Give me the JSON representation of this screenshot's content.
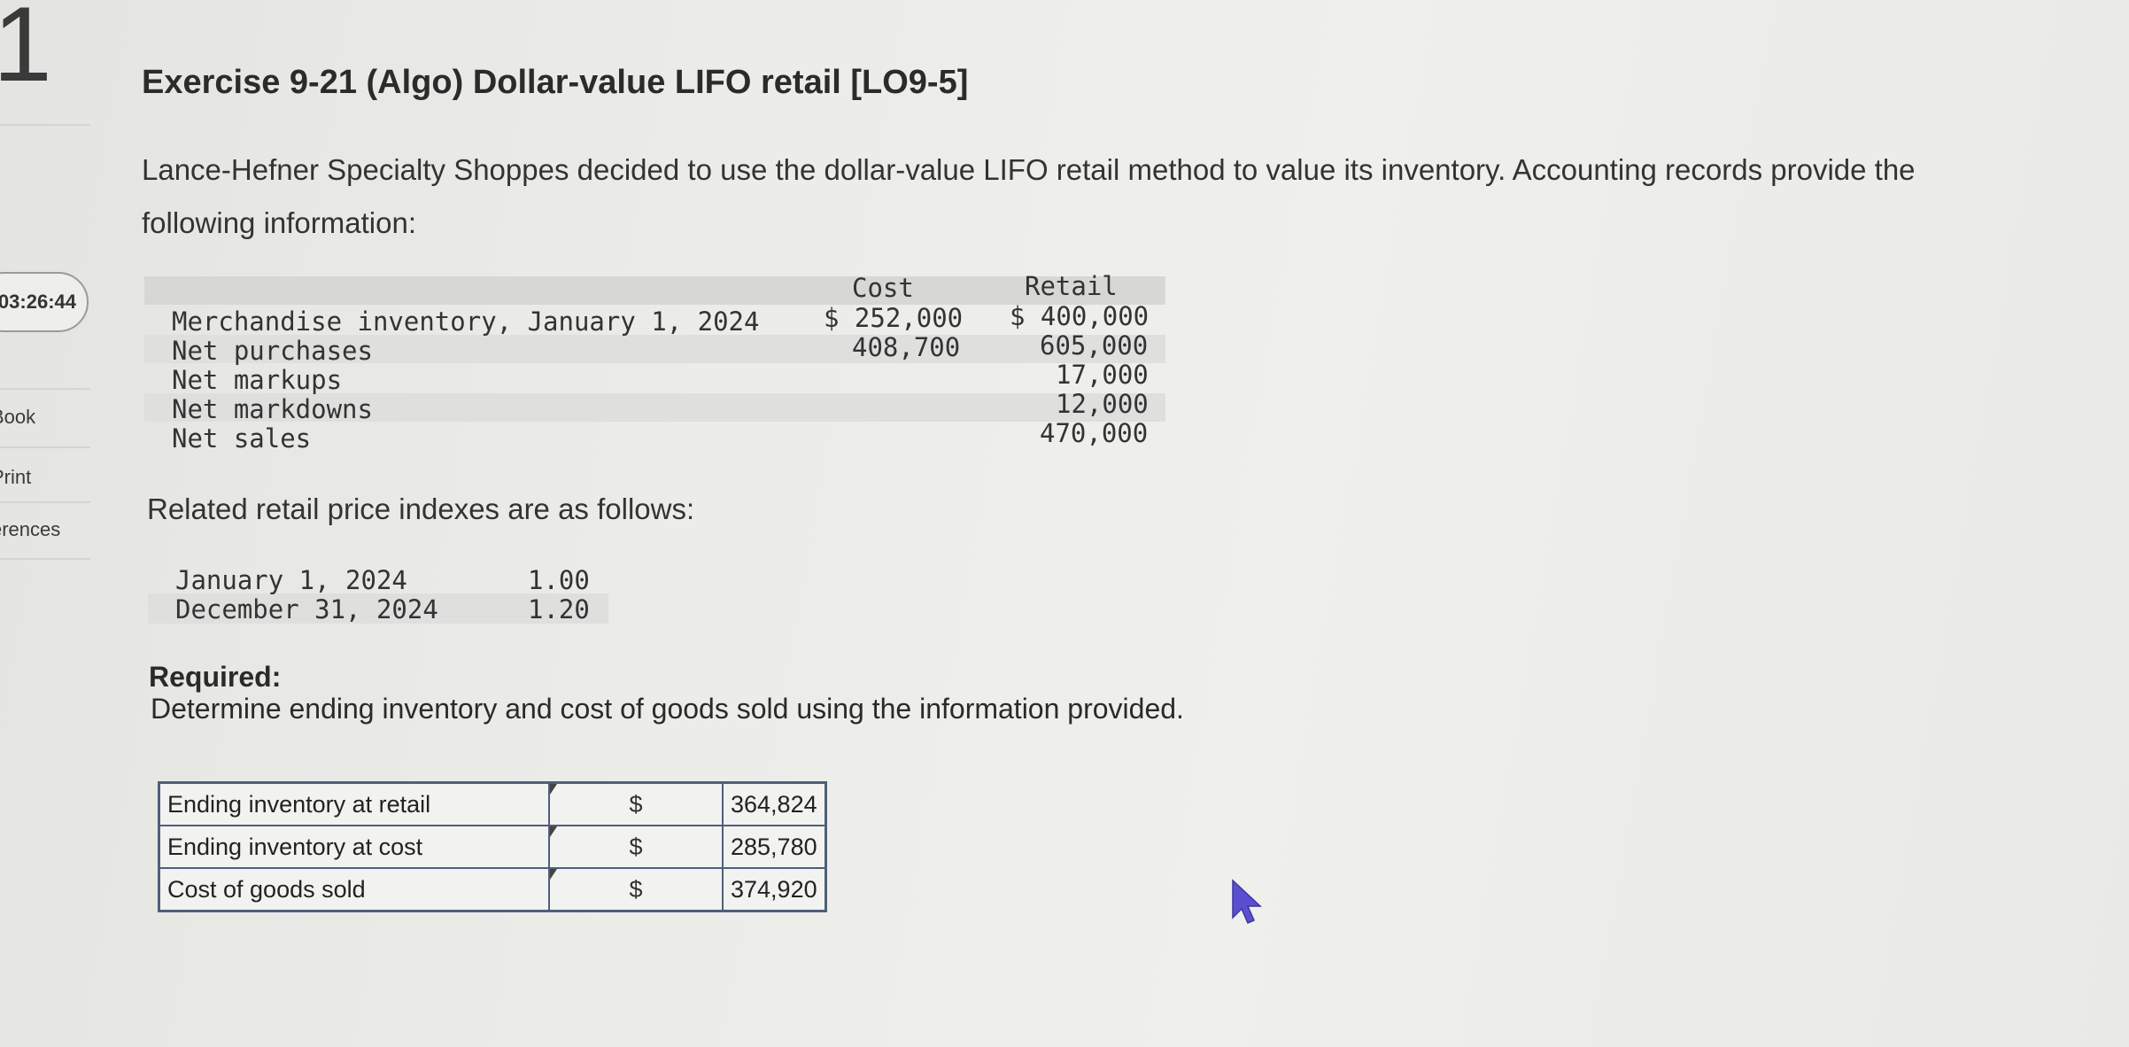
{
  "sidebar": {
    "page_number": "1",
    "timer": "03:26:44",
    "links": [
      "Book",
      "Print",
      "erences"
    ]
  },
  "exercise": {
    "title": "Exercise 9-21 (Algo) Dollar-value LIFO retail [LO9-5]",
    "intro": "Lance-Hefner Specialty Shoppes decided to use the dollar-value LIFO retail method to value its inventory. Accounting records provide the following information:"
  },
  "info_table": {
    "headers": {
      "cost": "Cost",
      "retail": "Retail"
    },
    "rows": [
      {
        "label": "Merchandise inventory, January 1, 2024",
        "cost": "$ 252,000",
        "retail": "$ 400,000"
      },
      {
        "label": "Net purchases",
        "cost": "408,700",
        "retail": "605,000"
      },
      {
        "label": "Net markups",
        "cost": "",
        "retail": "17,000"
      },
      {
        "label": "Net markdowns",
        "cost": "",
        "retail": "12,000"
      },
      {
        "label": "Net sales",
        "cost": "",
        "retail": "470,000"
      }
    ]
  },
  "indexes": {
    "intro": "Related retail price indexes are as follows:",
    "rows": [
      {
        "date": "January 1, 2024",
        "value": "1.00"
      },
      {
        "date": "December 31, 2024",
        "value": "1.20"
      }
    ]
  },
  "required": {
    "heading": "Required:",
    "text": "Determine ending inventory and cost of goods sold using the information provided."
  },
  "answers": [
    {
      "label": "Ending inventory at retail",
      "symbol": "$",
      "value": "364,824"
    },
    {
      "label": "Ending inventory at cost",
      "symbol": "$",
      "value": "285,780"
    },
    {
      "label": "Cost of goods sold",
      "symbol": "$",
      "value": "374,920"
    }
  ]
}
